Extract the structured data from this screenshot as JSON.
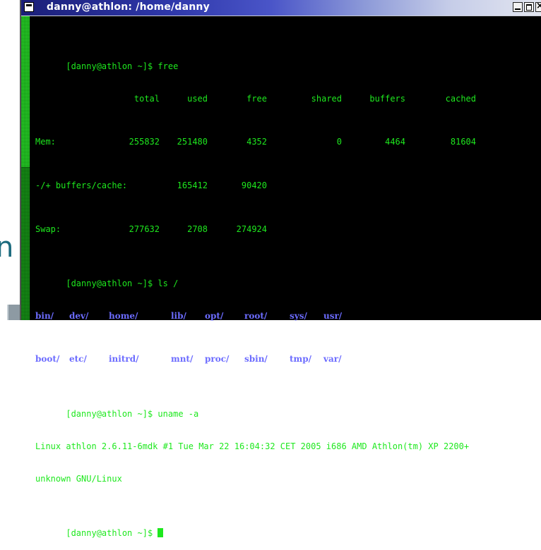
{
  "window": {
    "title": "danny@athlon: /home/danny"
  },
  "background": {
    "letter": "n"
  },
  "terminal": {
    "prompt": "[danny@athlon ~]$",
    "cmd_free": "free",
    "free_headers": [
      "total",
      "used",
      "free",
      "shared",
      "buffers",
      "cached"
    ],
    "mem": {
      "label": "Mem:",
      "values": [
        "255832",
        "251480",
        "4352",
        "0",
        "4464",
        "81604"
      ]
    },
    "buffers_cache": {
      "label": "-/+ buffers/cache:",
      "values": [
        "165412",
        "90420"
      ]
    },
    "swap": {
      "label": "Swap:",
      "values": [
        "277632",
        "2708",
        "274924"
      ]
    },
    "cmd_ls": "ls /",
    "ls_row1": [
      "bin/",
      "dev/",
      "home/",
      "lib/",
      "opt/",
      "root/",
      "sys/",
      "usr/"
    ],
    "ls_row2": [
      "boot/",
      "etc/",
      "initrd/",
      "mnt/",
      "proc/",
      "sbin/",
      "tmp/",
      "var/"
    ],
    "cmd_uname": "uname -a",
    "uname_line1": "Linux athlon 2.6.11-6mdk #1 Tue Mar 22 16:04:32 CET 2005 i686 AMD Athlon(tm) XP 2200+",
    "uname_line2": "unknown GNU/Linux"
  },
  "colors": {
    "terminal_text": "#1ee81e",
    "directory": "#6c6cff",
    "scrollbar": "#18a018"
  }
}
